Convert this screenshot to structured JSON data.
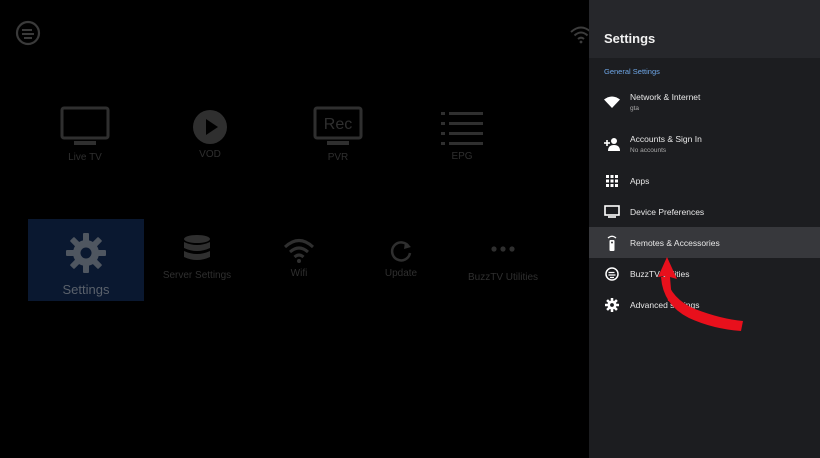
{
  "launcher": {
    "logo_icon": "buzztv-logo-icon",
    "status_wifi_icon": "wifi-icon",
    "top_row": [
      {
        "label": "Live TV",
        "icon": "tv-icon"
      },
      {
        "label": "VOD",
        "icon": "play-icon"
      },
      {
        "label": "PVR",
        "icon": "rec-icon"
      },
      {
        "label": "EPG",
        "icon": "list-icon"
      }
    ],
    "rec_text": "Rec",
    "settings_tile": {
      "label": "Settings",
      "icon": "gear-icon"
    },
    "bottom_row": [
      {
        "label": "Server Settings",
        "icon": "database-icon"
      },
      {
        "label": "Wifi",
        "icon": "wifi-icon"
      },
      {
        "label": "Update",
        "icon": "refresh-icon"
      },
      {
        "label": "BuzzTV Utilities",
        "icon": "dots-icon"
      }
    ]
  },
  "panel": {
    "title": "Settings",
    "section": "General Settings",
    "items": [
      {
        "label": "Network & Internet",
        "sub": "gta",
        "icon": "wifi-icon"
      },
      {
        "label": "Accounts & Sign In",
        "sub": "No accounts",
        "icon": "add-person-icon"
      },
      {
        "label": "Apps",
        "icon": "apps-grid-icon"
      },
      {
        "label": "Device Preferences",
        "icon": "monitor-icon"
      },
      {
        "label": "Remotes & Accessories",
        "icon": "remote-icon",
        "selected": true
      },
      {
        "label": "BuzzTV Utilities",
        "icon": "buzztv-icon"
      },
      {
        "label": "Advanced settings",
        "icon": "gear-icon"
      }
    ]
  },
  "colors": {
    "panel_bg": "#1c1d20",
    "panel_header_bg": "#26272b",
    "selected_bg": "#37383c",
    "section_title": "#6ea6e6",
    "annotation_arrow": "#e8101c",
    "settings_tile_bg": "#0a1830"
  }
}
